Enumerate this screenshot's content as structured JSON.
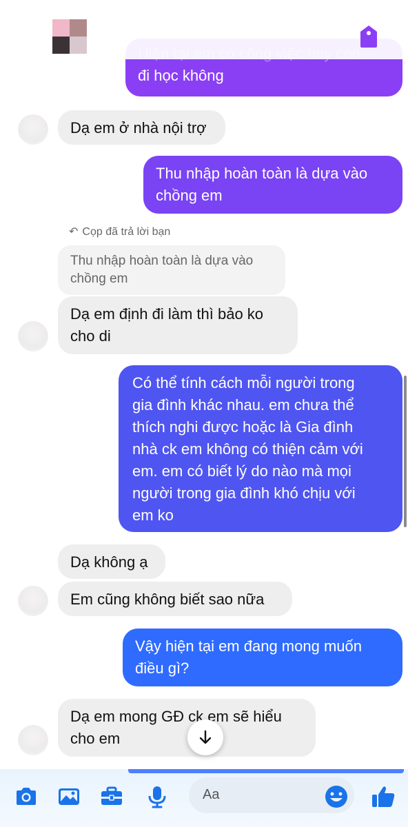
{
  "header": {
    "avatar_name": "blurred-avatar"
  },
  "messages": {
    "m0": "Hiện tại em có công việc hay còn đi học không",
    "m0_top": "Hiện tại em có công việc hay còn",
    "m0_bottom": "đi học không",
    "m1": "Dạ em ở nhà nội trợ",
    "m2_line1": "Thu nhập hoàn toàn là dựa vào",
    "m2_line2": "chồng em",
    "reply_note": "Cọp đã trả lời bạn",
    "quote_line1": "Thu nhập hoàn toàn là dựa vào",
    "quote_line2": "chồng em",
    "m3_line1": "Dạ em định đi làm thì bảo ko",
    "m3_line2": "cho di",
    "m4_l1": "Có thể tính cách mỗi người trong",
    "m4_l2": "gia đình khác nhau. em chưa thể",
    "m4_l3": "thích nghi được hoặc là Gia đình",
    "m4_l4": "nhà ck em không có thiện cảm với",
    "m4_l5": "em. em có biết lý do nào mà mọi",
    "m4_l6": "người trong gia đình khó chịu với",
    "m4_l7": "em ko",
    "m5": "Dạ không ạ",
    "m6": "Em cũng không biết sao nữa",
    "m7_line1": "Vậy hiện tại em đang mong muốn",
    "m7_line2": "điều gì?",
    "m8_line1": "Dạ em mong GĐ ck em sẽ hiểu",
    "m8_line2": "cho em"
  },
  "composer": {
    "placeholder": "Aa"
  },
  "icons": [
    "camera-icon",
    "gallery-icon",
    "briefcase-icon",
    "mic-icon",
    "emoji-icon",
    "thumbs-up-icon",
    "arrow-down-icon",
    "tag-icon"
  ],
  "colors": {
    "outgoing_top": "#8a3ff5",
    "outgoing_mid": "#5a50f0",
    "outgoing_bottom": "#2f6bff",
    "incoming": "#eeeeee",
    "accent_icons": "#1a73e8"
  }
}
